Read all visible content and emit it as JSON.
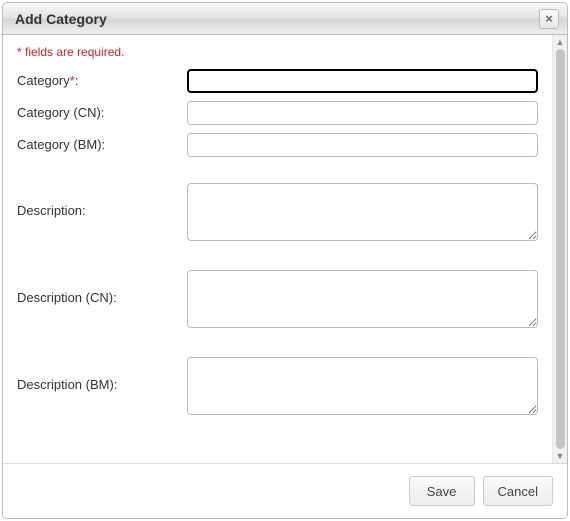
{
  "dialog": {
    "title": "Add Category",
    "close_icon": "×"
  },
  "note": "* fields are required.",
  "fields": {
    "category": {
      "label": "Category",
      "required_mark": "*",
      "colon": ":",
      "value": ""
    },
    "category_cn": {
      "label": "Category (CN):",
      "value": ""
    },
    "category_bm": {
      "label": "Category (BM):",
      "value": ""
    },
    "description": {
      "label": "Description:",
      "value": ""
    },
    "description_cn": {
      "label": "Description (CN):",
      "value": ""
    },
    "description_bm": {
      "label": "Description (BM):",
      "value": ""
    }
  },
  "buttons": {
    "save": "Save",
    "cancel": "Cancel"
  }
}
